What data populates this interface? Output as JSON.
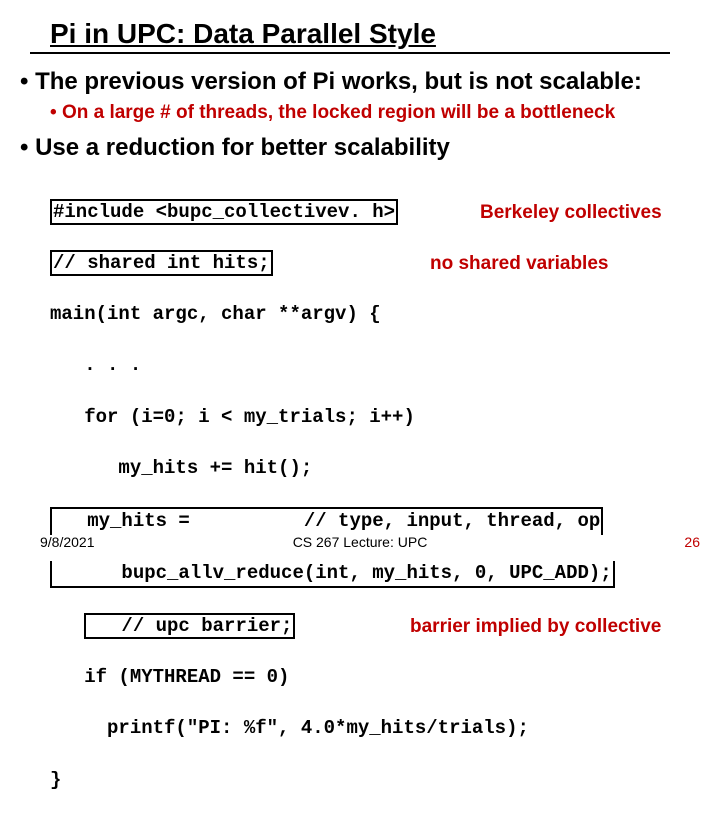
{
  "title": "Pi in UPC: Data Parallel Style",
  "bullets": {
    "b1a": "The previous version of Pi works, but is not scalable:",
    "b2a": "On a large # of threads, the locked region will be a bottleneck",
    "b1b": "Use a reduction for better scalability"
  },
  "code": {
    "l1": "#include <bupc_collectivev. h>",
    "l2": "// shared int hits;",
    "l3": "main(int argc, char **argv) {",
    "l4": "   . . .",
    "l5": "   for (i=0; i < my_trials; i++)",
    "l6": "      my_hits += hit();",
    "l7": "   my_hits =          // type, input, thread, op",
    "l8": "      bupc_allv_reduce(int, my_hits, 0, UPC_ADD);",
    "l9": "   // upc barrier;",
    "l10": "   if (MYTHREAD == 0)",
    "l11": "     printf(\"PI: %f\", 4.0*my_hits/trials);",
    "l12": "}"
  },
  "annotations": {
    "a1": "Berkeley collectives",
    "a2": "no shared variables",
    "a3": "barrier implied by collective"
  },
  "footer": {
    "date": "9/8/2021",
    "mid": "CS 267 Lecture: UPC",
    "page": "26"
  }
}
